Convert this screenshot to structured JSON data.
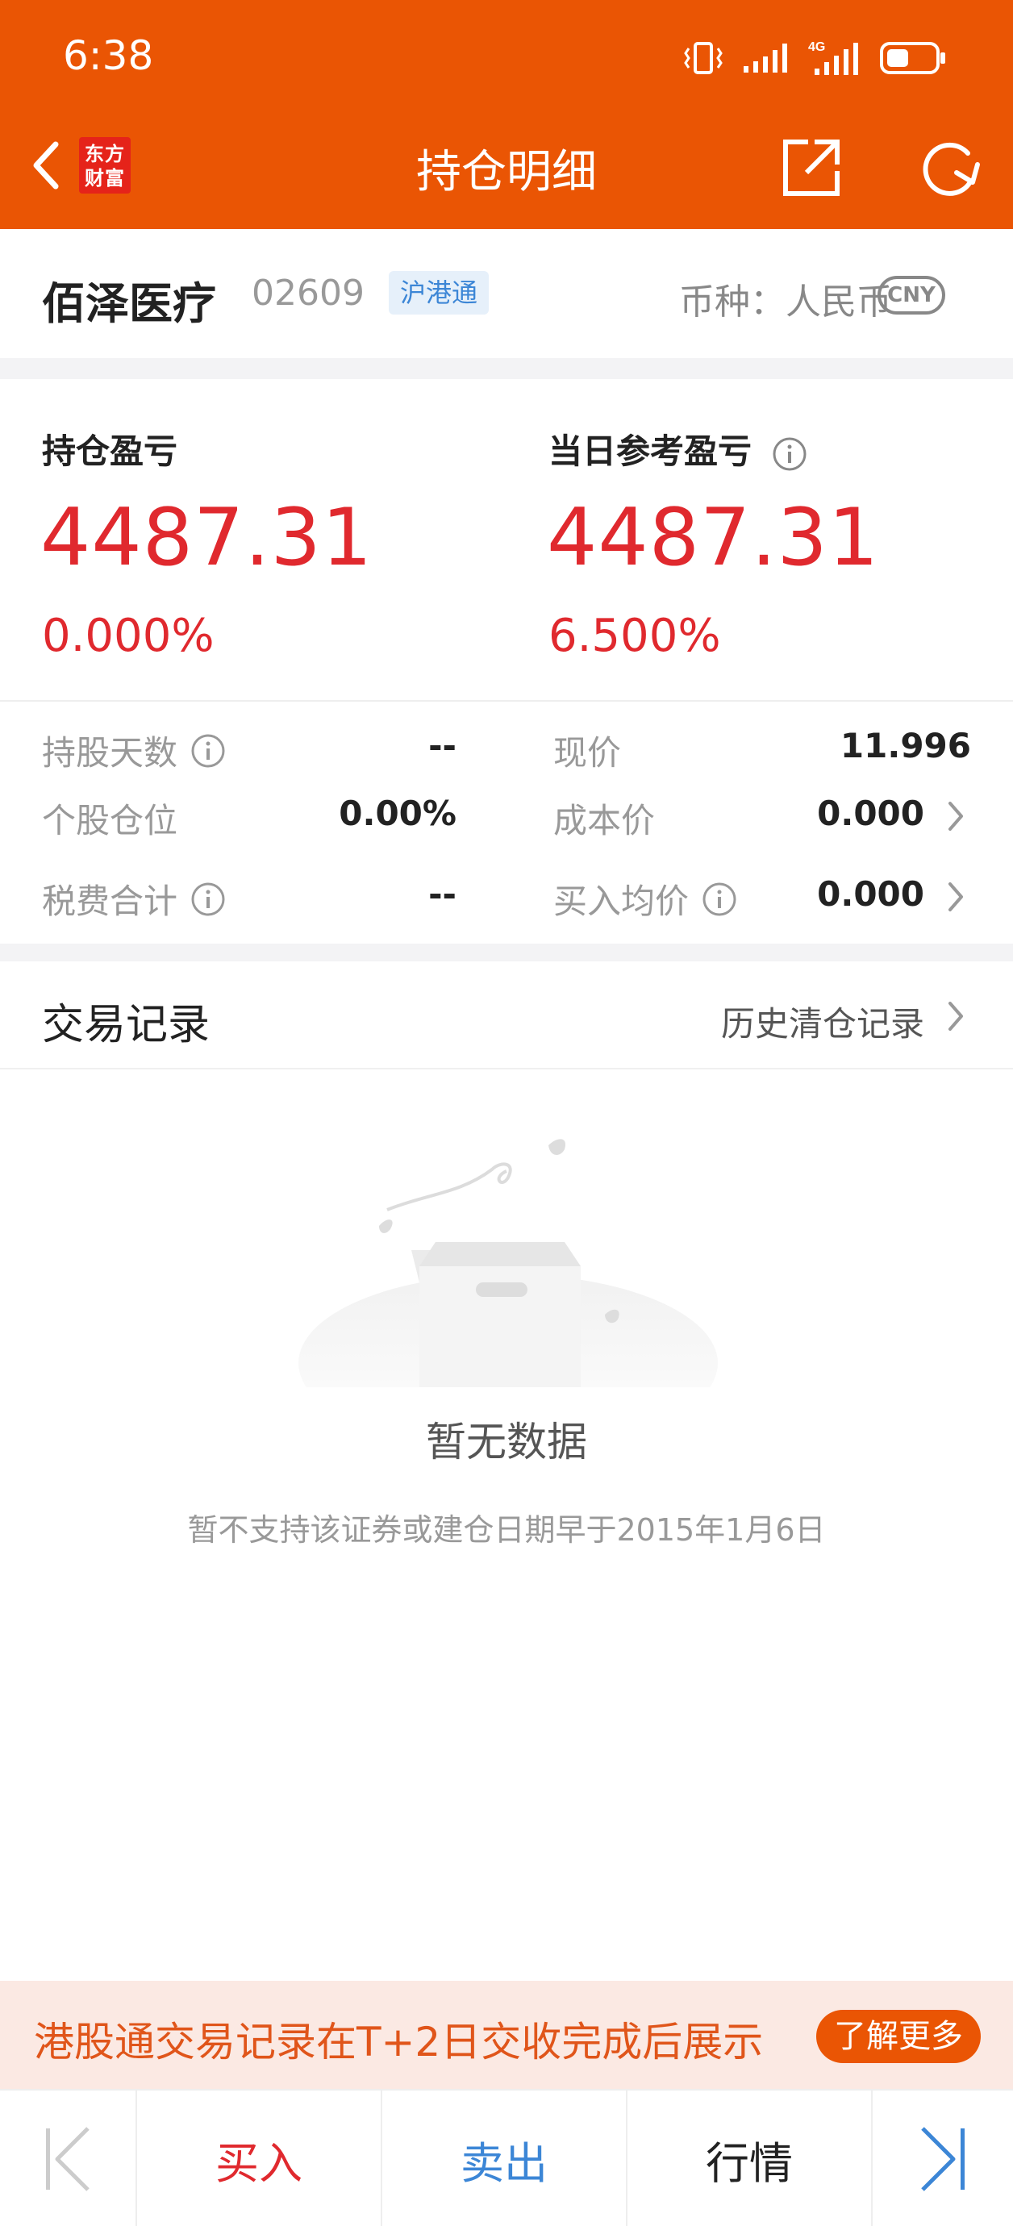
{
  "status": {
    "time": "6:38",
    "network": "4G"
  },
  "nav": {
    "title": "持仓明细",
    "logo_line1": "东方",
    "logo_line2": "财富"
  },
  "stock": {
    "name": "佰泽医疗",
    "code": "02609",
    "tag": "沪港通",
    "currency_label": "币种：人民币",
    "currency_badge": "CNY"
  },
  "pnl": {
    "position_label": "持仓盈亏",
    "position_value": "4487.31",
    "position_pct": "0.000%",
    "daily_label": "当日参考盈亏",
    "daily_value": "4487.31",
    "daily_pct": "6.500%"
  },
  "stats": {
    "hold_days_label": "持股天数",
    "hold_days_value": "--",
    "current_price_label": "现价",
    "current_price_value": "11.996",
    "position_ratio_label": "个股仓位",
    "position_ratio_value": "0.00%",
    "cost_price_label": "成本价",
    "cost_price_value": "0.000",
    "tax_fee_label": "税费合计",
    "tax_fee_value": "--",
    "avg_buy_label": "买入均价",
    "avg_buy_value": "0.000"
  },
  "records": {
    "title": "交易记录",
    "history_link": "历史清仓记录",
    "empty_title": "暂无数据",
    "empty_subtitle": "暂不支持该证券或建仓日期早于2015年1月6日"
  },
  "banner": {
    "text": "港股通交易记录在T+2日交收完成后展示",
    "button": "了解更多"
  },
  "toolbar": {
    "buy": "买入",
    "sell": "卖出",
    "quote": "行情"
  },
  "colors": {
    "brand_orange": "#EA5504",
    "profit_red": "#E0292E",
    "link_blue": "#3C86D6"
  }
}
